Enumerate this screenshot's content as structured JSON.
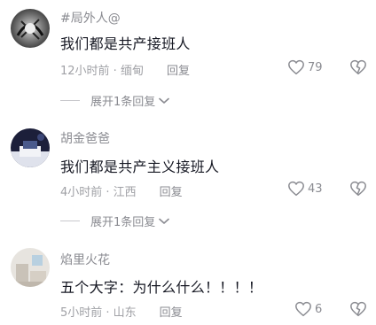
{
  "comments": [
    {
      "username": "#局外人@",
      "text": "我们都是共产接班人",
      "time_location": "12小时前 · 缅甸",
      "reply_label": "回复",
      "likes": "79",
      "expand_label": "展开1条回复"
    },
    {
      "username": "胡金爸爸",
      "text": "我们都是共产主义接班人",
      "time_location": "4小时前 · 江西",
      "reply_label": "回复",
      "likes": "43",
      "expand_label": "展开1条回复"
    },
    {
      "username": "焰里火花",
      "text": "五个大字：为什么什么！！！！",
      "time_location": "5小时前 · 山东",
      "reply_label": "回复",
      "likes": "6"
    }
  ],
  "icons": {
    "like": "heart-outline-icon",
    "dislike": "broken-heart-icon",
    "expand": "chevron-down-icon"
  },
  "colors": {
    "primary_text": "#161823",
    "secondary_text": "#8a8b91"
  }
}
